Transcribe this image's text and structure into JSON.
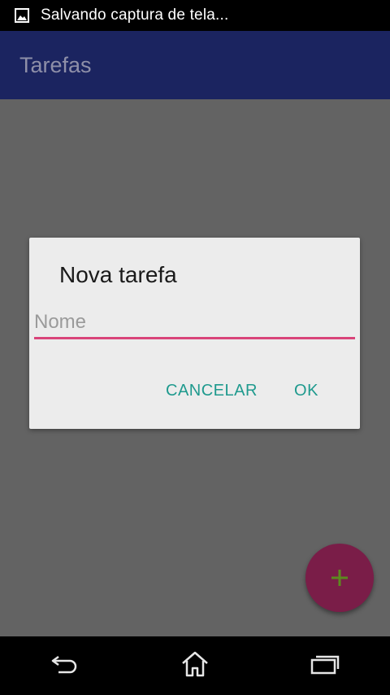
{
  "status_bar": {
    "notification_icon": "image-icon",
    "text": "Salvando captura de tela..."
  },
  "app_bar": {
    "title": "Tarefas"
  },
  "dialog": {
    "title": "Nova tarefa",
    "input": {
      "placeholder": "Nome",
      "value": ""
    },
    "buttons": {
      "cancel": "CANCELAR",
      "ok": "OK"
    }
  },
  "fab": {
    "icon": "plus-icon"
  },
  "nav_bar": {
    "icons": [
      "back-icon",
      "home-icon",
      "recent-apps-icon"
    ]
  },
  "colors": {
    "app_bar": "#1b2460",
    "scrim": "#636363",
    "dialog": "#ececec",
    "input_underline": "#d9447a",
    "button_text": "#1f9a8e",
    "fab": "#7a1d48",
    "fab_icon": "#5c8a1e"
  }
}
